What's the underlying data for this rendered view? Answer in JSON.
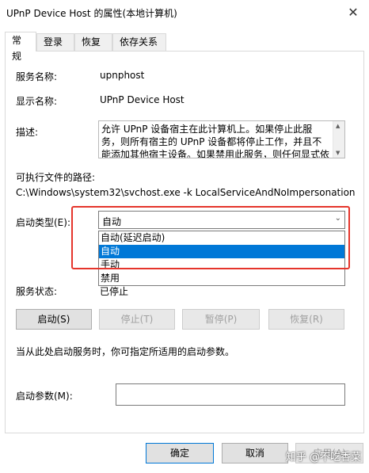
{
  "window": {
    "title": "UPnP Device Host 的属性(本地计算机)",
    "close_glyph": "✕"
  },
  "tabs": [
    {
      "label": "常规"
    },
    {
      "label": "登录"
    },
    {
      "label": "恢复"
    },
    {
      "label": "依存关系"
    }
  ],
  "general": {
    "service_name_label": "服务名称:",
    "service_name_value": "upnphost",
    "display_name_label": "显示名称:",
    "display_name_value": "UPnP Device Host",
    "description_label": "描述:",
    "description_value": "允许 UPnP 设备宿主在此计算机上。如果停止此服务，则所有宿主的 UPnP 设备都将停止工作，并且不能添加其他宿主设备。如果禁用此服务，则任何显式依赖于它的服务将无法启动。",
    "exe_path_label": "可执行文件的路径:",
    "exe_path_value": "C:\\Windows\\system32\\svchost.exe -k LocalServiceAndNoImpersonation",
    "startup_type_label": "启动类型(E):",
    "startup_type_selected": "自动",
    "startup_type_options": [
      "自动(延迟启动)",
      "自动",
      "手动",
      "禁用"
    ],
    "service_status_label": "服务状态:",
    "service_status_value": "已停止",
    "hint_text": "当从此处启动服务时，你可指定所适用的启动参数。",
    "start_params_label": "启动参数(M):"
  },
  "buttons": {
    "start": "启动(S)",
    "stop": "停止(T)",
    "pause": "暂停(P)",
    "resume": "恢复(R)",
    "ok": "确定",
    "cancel": "取消",
    "apply": "应用(A)"
  },
  "watermark": "知乎 @不吃香菜",
  "colors": {
    "selection": "#0078d7",
    "highlight_border": "#e5352c"
  },
  "icons": {
    "close": "close-icon",
    "dropdown": "chevron-down-icon"
  }
}
